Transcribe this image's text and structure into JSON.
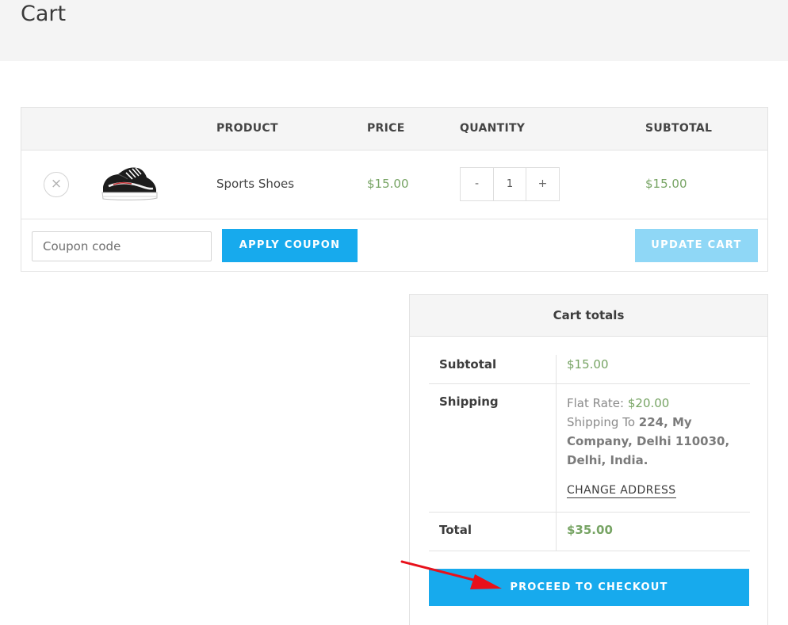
{
  "page": {
    "title": "Cart"
  },
  "cart_table": {
    "headers": {
      "product": "PRODUCT",
      "price": "PRICE",
      "quantity": "QUANTITY",
      "subtotal": "SUBTOTAL"
    },
    "items": [
      {
        "remove_icon": "×",
        "image": "sneaker-image",
        "name": "Sports Shoes",
        "price": "$15.00",
        "qty_minus": "-",
        "quantity": "1",
        "qty_plus": "+",
        "subtotal": "$15.00"
      }
    ]
  },
  "coupon": {
    "placeholder": "Coupon code",
    "apply_label": "APPLY COUPON",
    "update_label": "UPDATE CART"
  },
  "totals": {
    "title": "Cart totals",
    "subtotal_label": "Subtotal",
    "subtotal_value": "$15.00",
    "shipping_label": "Shipping",
    "shipping_method": "Flat Rate: ",
    "shipping_amount": "$20.00",
    "shipping_to": "Shipping To ",
    "shipping_address": "224, My Company, Delhi 110030, Delhi, India.",
    "change_address": "CHANGE ADDRESS",
    "total_label": "Total",
    "total_value": "$35.00"
  },
  "checkout": {
    "label": "PROCEED TO CHECKOUT"
  },
  "annotation": {
    "arrow_icon": "red-arrow-icon",
    "arrow_color": "#e8101a"
  },
  "colors": {
    "accent": "#17aaed",
    "accent_light": "#8fd7f6",
    "price_green": "#77a464"
  }
}
